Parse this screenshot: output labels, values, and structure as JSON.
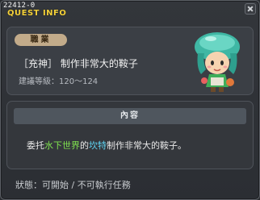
{
  "window": {
    "quest_id": "22412-0",
    "title": "QUEST INFO"
  },
  "job_panel": {
    "tag_label": "職業",
    "job_name": "［充神］ 制作非常大的鞍子",
    "level_text": "建議等級：120～124"
  },
  "content_panel": {
    "header": "內容",
    "desc_prefix": "委托",
    "desc_place": "水下世界",
    "desc_mid": "的",
    "desc_npc": "坎特",
    "desc_suffix": "制作非常大的鞍子。"
  },
  "status": {
    "text": "狀態：可開始 / 不可執行任務"
  },
  "colors": {
    "title": "#f5d23a",
    "place": "#7fe04f",
    "npc": "#5fd2f0",
    "tag_bg": "#c2ab8a"
  },
  "icons": [
    "close-icon",
    "npc-avatar-icon"
  ]
}
